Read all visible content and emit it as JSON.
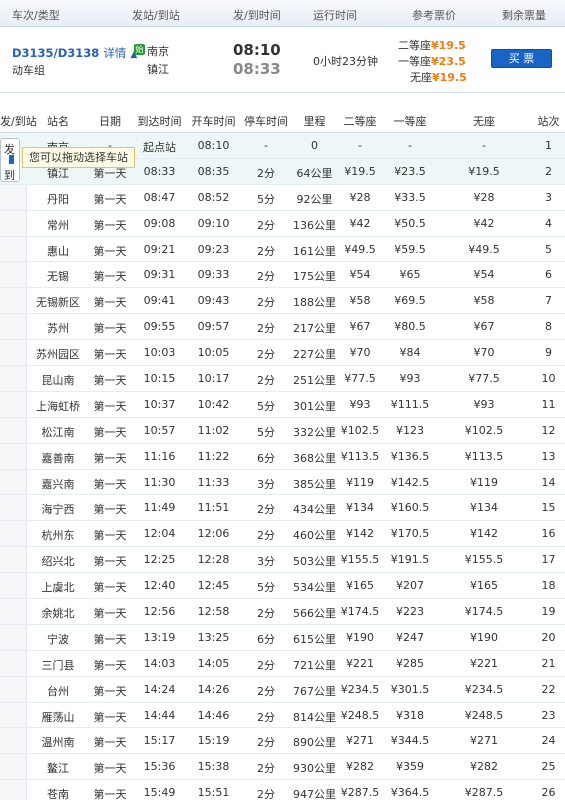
{
  "header": {
    "train_type": "车次/类型",
    "stations": "发站/到站",
    "times": "发/到时间",
    "duration": "运行时间",
    "price": "参考票价",
    "remaining": "剩余票量"
  },
  "train": {
    "code": "D3135/D3138",
    "detail_label": "详情",
    "type": "动车组",
    "start_icon": "始",
    "from": "南京",
    "to": "镇江",
    "depart": "08:10",
    "arrive": "08:33",
    "duration": "0小时23分钟",
    "prices": [
      {
        "label": "二等座",
        "value": "¥19.5"
      },
      {
        "label": "一等座",
        "value": "¥23.5"
      },
      {
        "label": "无座",
        "value": "¥19.5"
      }
    ],
    "buy_label": "买 票"
  },
  "drag": {
    "from": "发",
    "to": "到",
    "tip": "您可以拖动选择车站"
  },
  "stop_table": {
    "columns": [
      "发/到站",
      "站名",
      "日期",
      "到达时间",
      "开车时间",
      "停车时间",
      "里程",
      "二等座",
      "一等座",
      "无座",
      "站次"
    ],
    "rows": [
      [
        "南京",
        "-",
        "起点站",
        "08:10",
        "-",
        "0",
        "-",
        "-",
        "-",
        "1"
      ],
      [
        "镇江",
        "第一天",
        "08:33",
        "08:35",
        "2分",
        "64公里",
        "¥19.5",
        "¥23.5",
        "¥19.5",
        "2"
      ],
      [
        "丹阳",
        "第一天",
        "08:47",
        "08:52",
        "5分",
        "92公里",
        "¥28",
        "¥33.5",
        "¥28",
        "3"
      ],
      [
        "常州",
        "第一天",
        "09:08",
        "09:10",
        "2分",
        "136公里",
        "¥42",
        "¥50.5",
        "¥42",
        "4"
      ],
      [
        "惠山",
        "第一天",
        "09:21",
        "09:23",
        "2分",
        "161公里",
        "¥49.5",
        "¥59.5",
        "¥49.5",
        "5"
      ],
      [
        "无锡",
        "第一天",
        "09:31",
        "09:33",
        "2分",
        "175公里",
        "¥54",
        "¥65",
        "¥54",
        "6"
      ],
      [
        "无锡新区",
        "第一天",
        "09:41",
        "09:43",
        "2分",
        "188公里",
        "¥58",
        "¥69.5",
        "¥58",
        "7"
      ],
      [
        "苏州",
        "第一天",
        "09:55",
        "09:57",
        "2分",
        "217公里",
        "¥67",
        "¥80.5",
        "¥67",
        "8"
      ],
      [
        "苏州园区",
        "第一天",
        "10:03",
        "10:05",
        "2分",
        "227公里",
        "¥70",
        "¥84",
        "¥70",
        "9"
      ],
      [
        "昆山南",
        "第一天",
        "10:15",
        "10:17",
        "2分",
        "251公里",
        "¥77.5",
        "¥93",
        "¥77.5",
        "10"
      ],
      [
        "上海虹桥",
        "第一天",
        "10:37",
        "10:42",
        "5分",
        "301公里",
        "¥93",
        "¥111.5",
        "¥93",
        "11"
      ],
      [
        "松江南",
        "第一天",
        "10:57",
        "11:02",
        "5分",
        "332公里",
        "¥102.5",
        "¥123",
        "¥102.5",
        "12"
      ],
      [
        "嘉善南",
        "第一天",
        "11:16",
        "11:22",
        "6分",
        "368公里",
        "¥113.5",
        "¥136.5",
        "¥113.5",
        "13"
      ],
      [
        "嘉兴南",
        "第一天",
        "11:30",
        "11:33",
        "3分",
        "385公里",
        "¥119",
        "¥142.5",
        "¥119",
        "14"
      ],
      [
        "海宁西",
        "第一天",
        "11:49",
        "11:51",
        "2分",
        "434公里",
        "¥134",
        "¥160.5",
        "¥134",
        "15"
      ],
      [
        "杭州东",
        "第一天",
        "12:04",
        "12:06",
        "2分",
        "460公里",
        "¥142",
        "¥170.5",
        "¥142",
        "16"
      ],
      [
        "绍兴北",
        "第一天",
        "12:25",
        "12:28",
        "3分",
        "503公里",
        "¥155.5",
        "¥191.5",
        "¥155.5",
        "17"
      ],
      [
        "上虞北",
        "第一天",
        "12:40",
        "12:45",
        "5分",
        "534公里",
        "¥165",
        "¥207",
        "¥165",
        "18"
      ],
      [
        "余姚北",
        "第一天",
        "12:56",
        "12:58",
        "2分",
        "566公里",
        "¥174.5",
        "¥223",
        "¥174.5",
        "19"
      ],
      [
        "宁波",
        "第一天",
        "13:19",
        "13:25",
        "6分",
        "615公里",
        "¥190",
        "¥247",
        "¥190",
        "20"
      ],
      [
        "三门县",
        "第一天",
        "14:03",
        "14:05",
        "2分",
        "721公里",
        "¥221",
        "¥285",
        "¥221",
        "21"
      ],
      [
        "台州",
        "第一天",
        "14:24",
        "14:26",
        "2分",
        "767公里",
        "¥234.5",
        "¥301.5",
        "¥234.5",
        "22"
      ],
      [
        "雁荡山",
        "第一天",
        "14:44",
        "14:46",
        "2分",
        "814公里",
        "¥248.5",
        "¥318",
        "¥248.5",
        "23"
      ],
      [
        "温州南",
        "第一天",
        "15:17",
        "15:19",
        "2分",
        "890公里",
        "¥271",
        "¥344.5",
        "¥271",
        "24"
      ],
      [
        "鳌江",
        "第一天",
        "15:36",
        "15:38",
        "2分",
        "930公里",
        "¥282",
        "¥359",
        "¥282",
        "25"
      ],
      [
        "苍南",
        "第一天",
        "15:49",
        "15:51",
        "2分",
        "947公里",
        "¥287.5",
        "¥364.5",
        "¥287.5",
        "26"
      ]
    ]
  }
}
